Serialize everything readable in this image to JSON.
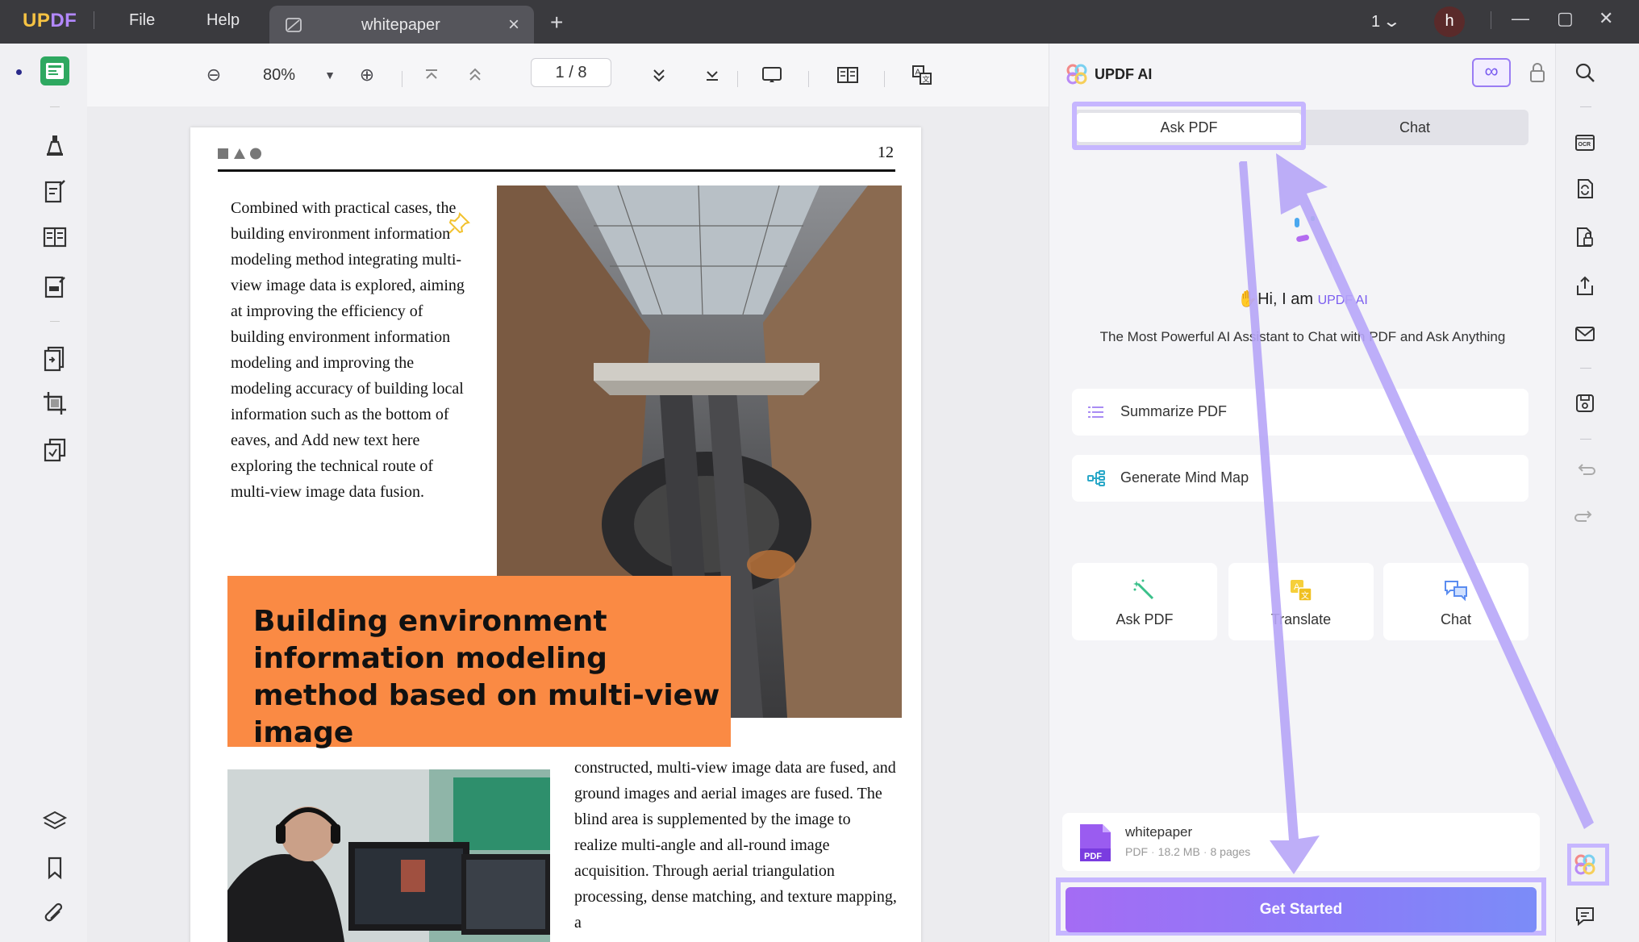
{
  "titlebar": {
    "logo": "UPDF",
    "menu": {
      "file": "File",
      "help": "Help"
    },
    "tab": {
      "label": "whitepaper"
    },
    "new_tab": "+",
    "count": "1",
    "avatar": "h"
  },
  "toolbar": {
    "zoom": "80%",
    "page_current": "1",
    "page_total": "8"
  },
  "document": {
    "page_number": "12",
    "col1_text": "Combined with practical cases, the building environment information modeling method integrating multi-view image data is explored, aiming at improving the efficiency of building environment information modeling and improving the modeling accuracy of building local information such as the bottom of eaves, and Add new text  here exploring the technical route of multi-view image data fusion.",
    "title_box": "Building environment information modeling method based on multi-view image",
    "col2_text": "constructed, multi-view image data are fused, and ground images and aerial images are fused. The blind area is supplemented by the image to realize multi-angle and all-round image acquisition. Through aerial triangulation processing, dense matching, and texture mapping, a"
  },
  "ai_panel": {
    "title": "UPDF AI",
    "tabs": {
      "ask_pdf": "Ask PDF",
      "chat": "Chat"
    },
    "greeting_prefix": "Hi, I am ",
    "greeting_brand": "UPDF AI",
    "subtitle": "The Most Powerful AI Assistant to Chat with PDF and Ask Anything",
    "actions": {
      "summarize": "Summarize PDF",
      "mindmap": "Generate Mind Map",
      "ask_pdf": "Ask PDF",
      "translate": "Translate",
      "chat": "Chat"
    },
    "file": {
      "name": "whitepaper",
      "type": "PDF",
      "size": "18.2 MB",
      "pages": "8 pages"
    },
    "get_started": "Get Started"
  },
  "colors": {
    "accent": "#7a5cf0",
    "highlight": "#c6b6ff",
    "orange": "#fa8a44",
    "green": "#2ea860"
  }
}
